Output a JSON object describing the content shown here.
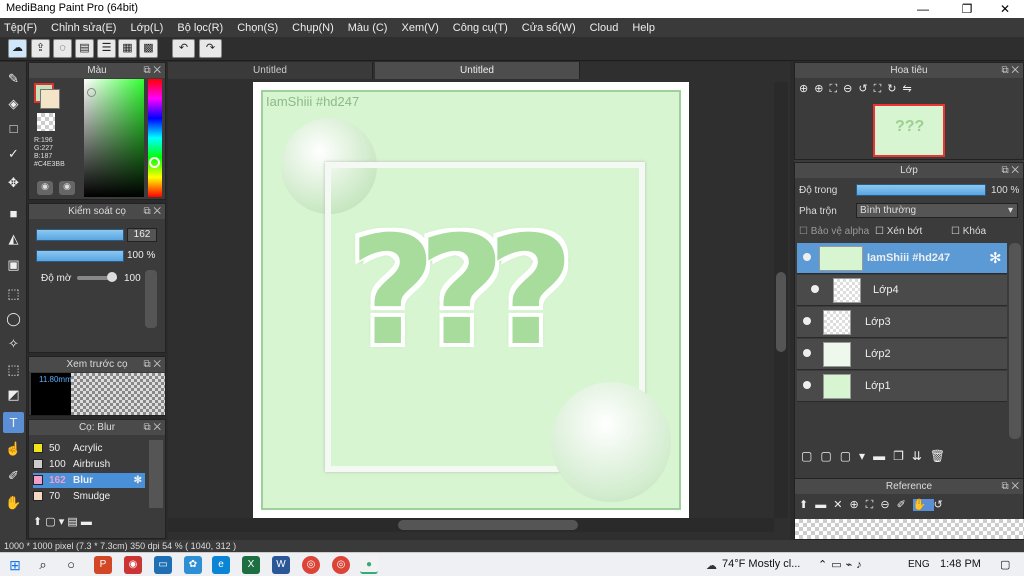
{
  "window": {
    "title": "MediBang Paint Pro (64bit)",
    "min": "—",
    "max": "❐",
    "close": "✕"
  },
  "menu": [
    "Tệp(F)",
    "Chỉnh sửa(E)",
    "Lớp(L)",
    "Bộ lọc(R)",
    "Chọn(S)",
    "Chụp(N)",
    "Màu (C)",
    "Xem(V)",
    "Công cụ(T)",
    "Cửa sổ(W)",
    "Cloud",
    "Help"
  ],
  "toolbar_icons": [
    "cloud-icon",
    "share-icon",
    "chat-icon",
    "panel-icon",
    "list-icon",
    "grid-icon",
    "undo-icon",
    "redo-icon"
  ],
  "color_panel": {
    "title": "Màu",
    "rgb": [
      "R:196",
      "G:227",
      "B:187",
      "#C4E3BB"
    ],
    "primary": "#C4E3BB",
    "secondary": "#f4e4c8"
  },
  "brush_control": {
    "title": "Kiểm soát cọ",
    "size": "162",
    "opacity": "100 %",
    "blur_label": "Độ mờ",
    "blur_value": "100",
    "opacity_fill": 1.0
  },
  "brush_preview": {
    "title": "Xem trước cọ",
    "size_text": "11.80mm"
  },
  "brush_list": {
    "title": "Cọ: Blur",
    "items": [
      {
        "size": "50",
        "name": "Acrylic",
        "color": "#f1e31c"
      },
      {
        "size": "100",
        "name": "Airbrush",
        "color": "#cccccc"
      },
      {
        "size": "162",
        "name": "Blur",
        "color": "#f29ec8"
      },
      {
        "size": "70",
        "name": "Smudge",
        "color": "#f3d9c0"
      }
    ]
  },
  "tabs": [
    "Untitled",
    "Untitled"
  ],
  "canvas": {
    "watermark": "IamShiii #hd247",
    "art_text": "???"
  },
  "navigator": {
    "title": "Hoa tiêu"
  },
  "layers_panel": {
    "title": "Lớp",
    "opacity_label": "Độ trong",
    "opacity_value": "100 %",
    "blend_label": "Pha trộn",
    "blend_value": "Bình thường",
    "protect_alpha": "Bảo vệ alpha",
    "clipping": "Xén bớt",
    "lock": "Khóa",
    "layers": [
      {
        "name": "IamShiii #hd247",
        "active": true
      },
      {
        "name": "Lớp4",
        "active": false
      },
      {
        "name": "Lớp3",
        "active": false
      },
      {
        "name": "Lớp2",
        "active": false
      },
      {
        "name": "Lớp1",
        "active": false
      }
    ]
  },
  "reference": {
    "title": "Reference"
  },
  "status": {
    "text": "1000 * 1000 pixel  (7.3 * 7.3cm)  350 dpi  54 %  ( 1040, 312 )"
  },
  "taskbar": {
    "weather": "74°F  Mostly cl...",
    "lang": "ENG",
    "time": "1:48 PM"
  }
}
